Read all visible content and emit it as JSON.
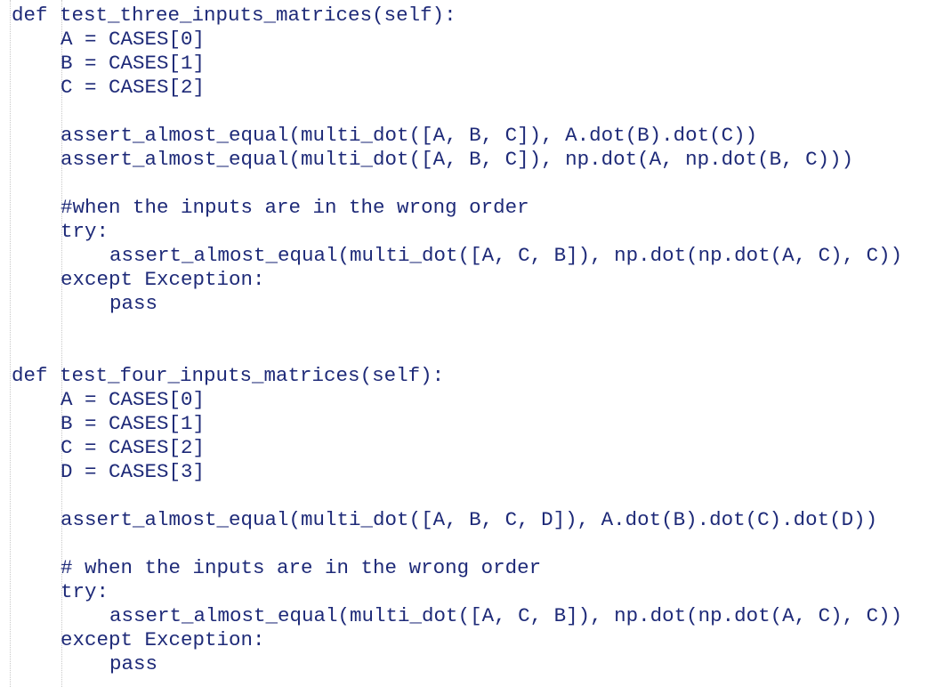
{
  "editor": {
    "text_color": "#1e2a78",
    "background": "#ffffff",
    "lines": [
      {
        "indent": 0,
        "text": "def test_three_inputs_matrices(self):"
      },
      {
        "indent": 1,
        "text": "A = CASES[0]"
      },
      {
        "indent": 1,
        "text": "B = CASES[1]"
      },
      {
        "indent": 1,
        "text": "C = CASES[2]"
      },
      {
        "indent": 0,
        "text": ""
      },
      {
        "indent": 1,
        "text": "assert_almost_equal(multi_dot([A, B, C]), A.dot(B).dot(C))"
      },
      {
        "indent": 1,
        "text": "assert_almost_equal(multi_dot([A, B, C]), np.dot(A, np.dot(B, C)))"
      },
      {
        "indent": 0,
        "text": ""
      },
      {
        "indent": 1,
        "text": "#when the inputs are in the wrong order"
      },
      {
        "indent": 1,
        "text": "try:"
      },
      {
        "indent": 2,
        "text": "assert_almost_equal(multi_dot([A, C, B]), np.dot(np.dot(A, C), C))"
      },
      {
        "indent": 1,
        "text": "except Exception:"
      },
      {
        "indent": 2,
        "text": "pass"
      },
      {
        "indent": 0,
        "text": ""
      },
      {
        "indent": 0,
        "text": ""
      },
      {
        "indent": 0,
        "text": "def test_four_inputs_matrices(self):"
      },
      {
        "indent": 1,
        "text": "A = CASES[0]"
      },
      {
        "indent": 1,
        "text": "B = CASES[1]"
      },
      {
        "indent": 1,
        "text": "C = CASES[2]"
      },
      {
        "indent": 1,
        "text": "D = CASES[3]"
      },
      {
        "indent": 0,
        "text": ""
      },
      {
        "indent": 1,
        "text": "assert_almost_equal(multi_dot([A, B, C, D]), A.dot(B).dot(C).dot(D))"
      },
      {
        "indent": 0,
        "text": ""
      },
      {
        "indent": 1,
        "text": "# when the inputs are in the wrong order"
      },
      {
        "indent": 1,
        "text": "try:"
      },
      {
        "indent": 2,
        "text": "assert_almost_equal(multi_dot([A, C, B]), np.dot(np.dot(A, C), C))"
      },
      {
        "indent": 1,
        "text": "except Exception:"
      },
      {
        "indent": 2,
        "text": "pass"
      }
    ]
  }
}
